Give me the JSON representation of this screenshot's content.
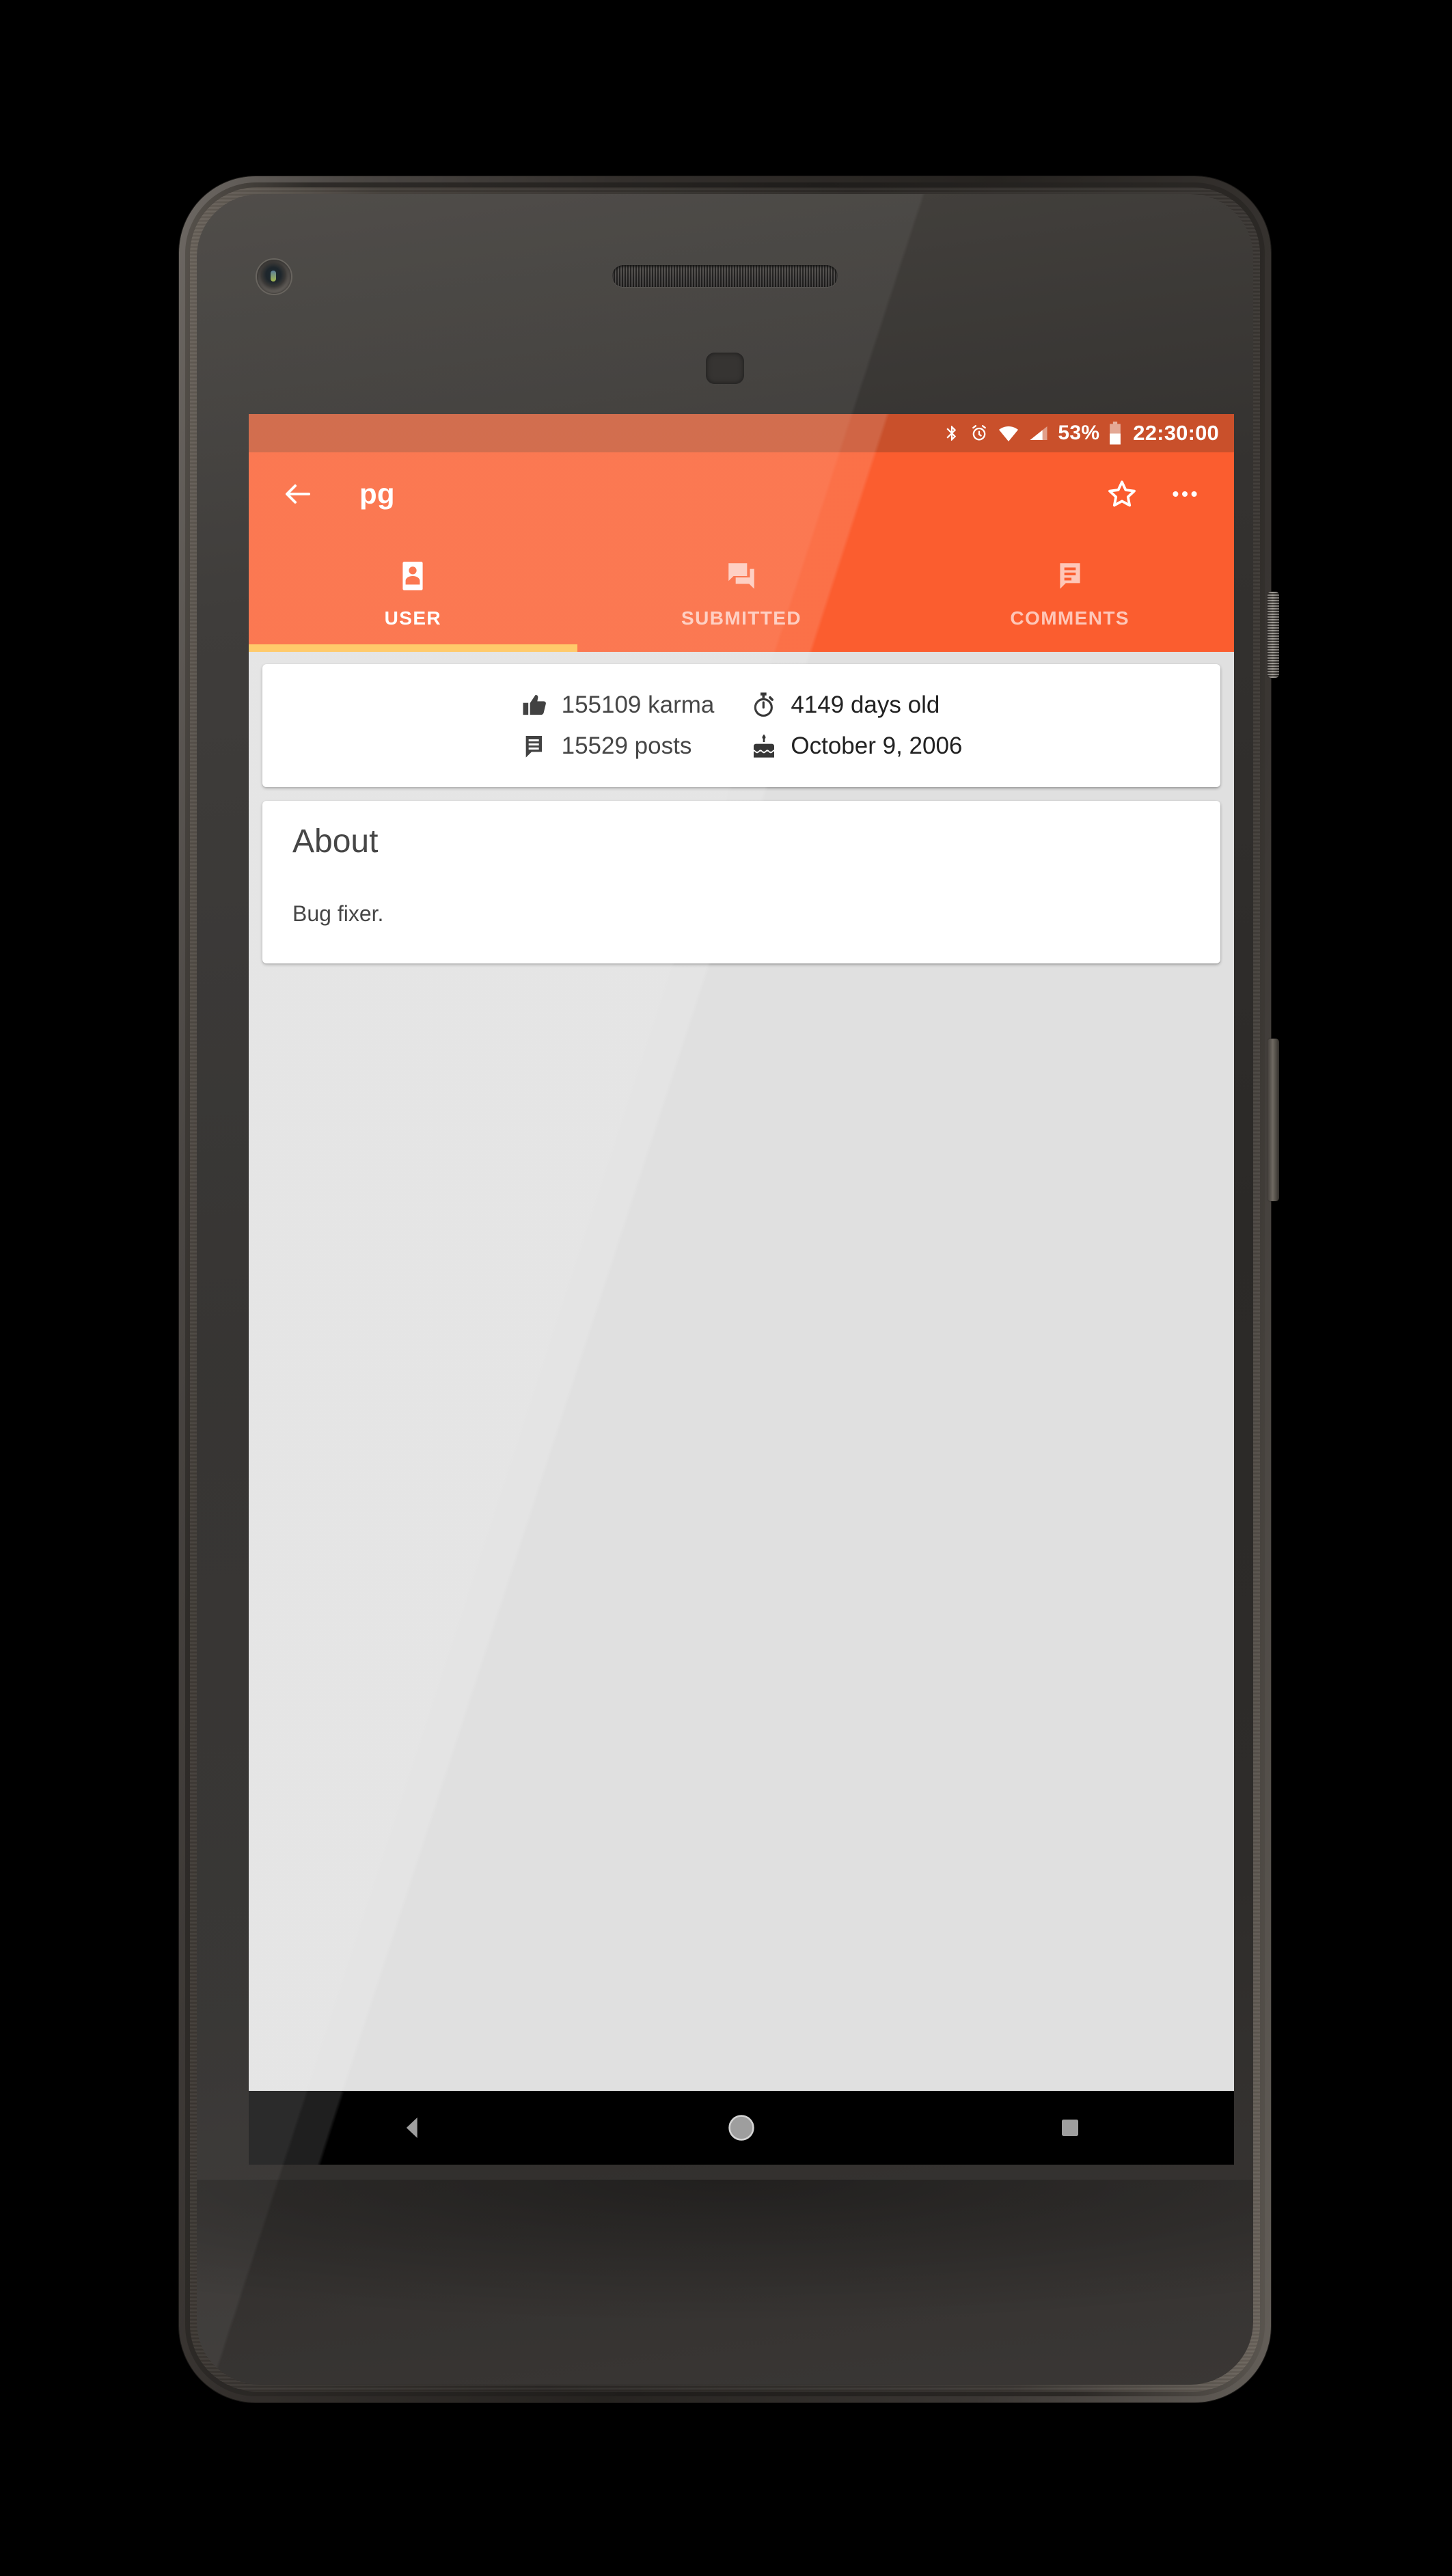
{
  "status_bar": {
    "icons": [
      "bluetooth-icon",
      "alarm-icon",
      "wifi-icon",
      "cellular-signal-icon"
    ],
    "battery_percent": "53%",
    "battery_icon": "battery-icon",
    "clock": "22:30:00",
    "background_color": "#C9502B"
  },
  "app_bar": {
    "back_icon": "back-arrow-icon",
    "title": "pg",
    "favorite_icon": "star-outline-icon",
    "overflow_icon": "more-horizontal-icon",
    "background_color": "#FB5D2F"
  },
  "tabs": {
    "indicator_color": "#FFC04D",
    "items": [
      {
        "label": "USER",
        "icon": "account-box-icon",
        "active": true
      },
      {
        "label": "SUBMITTED",
        "icon": "forum-icon",
        "active": false
      },
      {
        "label": "COMMENTS",
        "icon": "comment-list-icon",
        "active": false
      }
    ]
  },
  "stats_card": {
    "items": [
      {
        "icon": "thumb-up-icon",
        "text": "155109 karma"
      },
      {
        "icon": "timer-icon",
        "text": "4149 days old"
      },
      {
        "icon": "comment-icon",
        "text": "15529 posts"
      },
      {
        "icon": "cake-icon",
        "text": "October 9, 2006"
      }
    ]
  },
  "about_card": {
    "title": "About",
    "body": "Bug fixer."
  },
  "nav_bar": {
    "back": "nav-back-icon",
    "home": "nav-home-icon",
    "recents": "nav-recents-icon"
  },
  "theme": {
    "background": "#E0E0E0",
    "card": "#FFFFFF",
    "text_primary": "#212121"
  }
}
